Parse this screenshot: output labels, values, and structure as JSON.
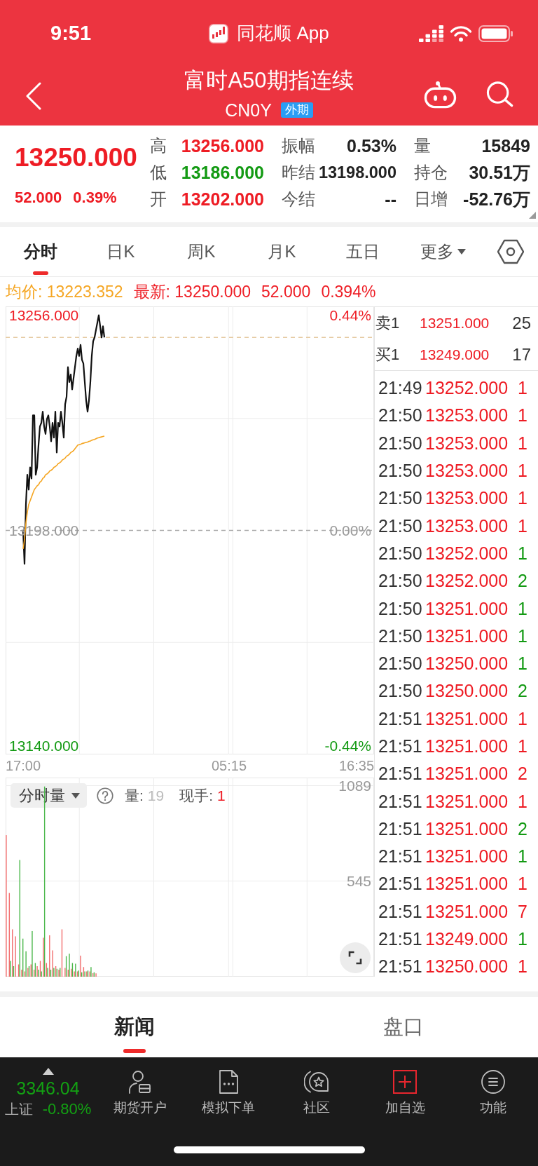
{
  "status_bar": {
    "time": "9:51",
    "app_name": "同花顺 App"
  },
  "header": {
    "title": "富时A50期指连续",
    "code": "CN0Y",
    "badge": "外期"
  },
  "quote": {
    "price": "13250.000",
    "change": "52.000",
    "change_percent": "0.39%",
    "color": "#ee1c24",
    "stats": [
      {
        "label": "高",
        "value": "13256.000",
        "color": "#ee1c24"
      },
      {
        "label": "振幅",
        "value": "0.53%",
        "color": "#222222"
      },
      {
        "label": "量",
        "value": "15849",
        "color": "#222222"
      },
      {
        "label": "低",
        "value": "13186.000",
        "color": "#139a13"
      },
      {
        "label": "昨结",
        "value": "13198.000",
        "color": "#222222"
      },
      {
        "label": "持仓",
        "value": "30.51万",
        "color": "#222222"
      },
      {
        "label": "开",
        "value": "13202.000",
        "color": "#ee1c24"
      },
      {
        "label": "今结",
        "value": "--",
        "color": "#222222"
      },
      {
        "label": "日增",
        "value": "-52.76万",
        "color": "#222222"
      }
    ]
  },
  "period_tabs": [
    {
      "label": "分时",
      "kind": "tab",
      "selected": true
    },
    {
      "label": "日K",
      "kind": "tab",
      "selected": false
    },
    {
      "label": "周K",
      "kind": "tab",
      "selected": false
    },
    {
      "label": "月K",
      "kind": "tab",
      "selected": false
    },
    {
      "label": "五日",
      "kind": "tab",
      "selected": false
    },
    {
      "label": "更多",
      "kind": "menu",
      "selected": false
    }
  ],
  "chart_info": {
    "average": "均价: 13223.352",
    "latest": "最新: 13250.000",
    "change": "52.000",
    "change_percent": "0.394%"
  },
  "price_chart": {
    "chart_data": {
      "type": "line",
      "categories": [
        "17:00",
        null,
        null,
        null,
        null,
        null,
        null,
        null,
        null,
        null,
        null,
        null,
        null,
        null,
        null,
        null,
        null,
        null,
        null,
        null,
        null,
        null,
        null,
        null,
        null,
        null,
        null,
        null,
        null,
        null,
        null,
        null,
        null,
        null,
        null,
        null,
        null,
        null,
        null,
        null,
        null,
        null,
        null,
        null,
        null,
        null,
        null,
        null,
        null,
        null,
        null,
        null,
        null,
        null,
        null,
        null,
        null,
        null,
        null,
        null,
        null,
        null,
        null,
        null,
        null,
        null,
        null,
        null,
        null,
        null,
        null,
        null,
        null,
        null,
        null,
        null,
        null,
        null,
        null,
        null,
        null,
        null,
        null,
        null,
        null,
        null,
        null,
        null,
        null,
        null,
        null,
        null,
        null,
        null,
        null,
        null,
        null,
        null,
        null,
        null,
        null,
        null,
        null,
        null,
        null,
        null,
        null,
        null,
        null,
        null,
        null,
        null,
        null,
        null,
        null,
        null,
        null,
        null,
        null,
        null,
        null,
        null,
        null,
        null,
        null,
        null,
        null,
        null,
        null,
        null,
        null,
        null,
        null,
        null,
        null,
        null,
        null,
        null,
        null,
        null,
        null,
        null,
        null,
        null,
        null,
        null,
        null,
        "05:15",
        null,
        null,
        null,
        null,
        null,
        null,
        null,
        null,
        null,
        null,
        null,
        null,
        null,
        null,
        null,
        null,
        null,
        null,
        null,
        null,
        null,
        null,
        null,
        null,
        null,
        null,
        null,
        null,
        null,
        null,
        null,
        null,
        null,
        null,
        null,
        null,
        null,
        null,
        null,
        null,
        null,
        null,
        null,
        null,
        null,
        null,
        null,
        null,
        null,
        null,
        null,
        null,
        null,
        null,
        null,
        null,
        null,
        null,
        null,
        null,
        null,
        null,
        null,
        null,
        null,
        null,
        null,
        null,
        null,
        null,
        null,
        null,
        null,
        null,
        null,
        null,
        null,
        null,
        null,
        null,
        null,
        null,
        null,
        null,
        null,
        null,
        null,
        null,
        null,
        null,
        "16:35"
      ],
      "series": [
        {
          "color": "#111111",
          "values": [
            13198,
            13189,
            13205,
            13213,
            13209,
            13215,
            13212,
            13229,
            13229,
            13213,
            13215,
            13221,
            13226,
            13227,
            13230,
            13226,
            13224,
            13228,
            13229,
            13226,
            13222,
            13227,
            13223,
            13230,
            13219,
            13227,
            13226,
            13230,
            13227,
            13223,
            13232,
            13234,
            13242,
            13238,
            13240,
            13236,
            13239,
            13242,
            13245,
            13247,
            13245,
            13248,
            13244,
            13243,
            13238,
            13233,
            13230,
            13233,
            13238,
            13245,
            13249,
            13250,
            13252,
            13254,
            13256,
            13253,
            13250,
            13253,
            13250,
            null,
            null,
            null,
            null,
            null,
            null,
            null,
            null,
            null,
            null,
            null,
            null,
            null,
            null,
            null,
            null,
            null,
            null,
            null,
            null,
            null,
            null,
            null,
            null,
            null,
            null,
            null,
            null,
            null,
            null,
            null,
            null,
            null,
            null,
            null,
            null,
            null,
            null,
            null,
            null,
            null,
            null,
            null,
            null,
            null,
            null,
            null,
            null,
            null,
            null,
            null,
            null,
            null,
            null,
            null,
            null,
            null,
            null,
            null,
            null,
            null,
            null,
            null,
            null,
            null,
            null,
            null,
            null,
            null,
            null,
            null,
            null,
            null,
            null,
            null,
            null,
            null,
            null,
            null,
            null,
            null,
            null,
            null,
            null,
            null,
            null,
            null,
            null,
            null,
            null,
            null,
            null,
            null,
            null,
            null,
            null,
            null,
            null,
            null,
            null,
            null,
            null,
            null,
            null,
            null,
            null,
            null,
            null,
            null,
            null,
            null,
            null,
            null,
            null,
            null,
            null,
            null,
            null,
            null,
            null,
            null,
            null,
            null,
            null,
            null,
            null,
            null,
            null,
            null,
            null,
            null,
            null,
            null,
            null,
            null,
            null,
            null,
            null,
            null,
            null,
            null,
            null,
            null,
            null,
            null,
            null,
            null,
            null,
            null,
            null,
            null,
            null,
            null,
            null,
            null,
            null,
            null,
            null,
            null,
            null,
            null,
            null,
            null,
            null,
            null,
            null,
            null,
            null,
            null,
            null,
            null,
            null,
            null,
            null,
            null,
            null,
            null,
            null,
            null,
            null
          ]
        },
        {
          "color": "#f5a623",
          "values": [
            13193,
            13195.5,
            13200,
            13203,
            13205,
            13206,
            13207,
            13208,
            13209,
            13209.5,
            13210,
            13210.3,
            13211,
            13211.3,
            13212,
            13212.3,
            13213,
            13213.2,
            13213.5,
            13214,
            13214.2,
            13214.5,
            13215,
            13215.2,
            13215.5,
            13216,
            13216.2,
            13216.5,
            13217,
            13217.2,
            13217.5,
            13218,
            13218.2,
            13218.5,
            13219,
            13219.2,
            13219.5,
            13220,
            13220.5,
            13221,
            13221.1,
            13221.2,
            13221.4,
            13221.5,
            13221.6,
            13221.7,
            13221.8,
            13222,
            13222.1,
            13222.3,
            13222.4,
            13222.5,
            13222.7,
            13222.9,
            13223,
            13223.1,
            13223.2,
            13223.3,
            13223.4,
            null,
            null,
            null,
            null,
            null,
            null,
            null,
            null,
            null,
            null,
            null,
            null,
            null,
            null,
            null,
            null,
            null,
            null,
            null,
            null,
            null,
            null,
            null,
            null,
            null,
            null,
            null,
            null,
            null,
            null,
            null,
            null,
            null,
            null,
            null,
            null,
            null,
            null,
            null,
            null,
            null,
            null,
            null,
            null,
            null,
            null,
            null,
            null,
            null,
            null,
            null,
            null,
            null,
            null,
            null,
            null,
            null,
            null,
            null,
            null,
            null,
            null,
            null,
            null,
            null,
            null,
            null,
            null,
            null,
            null,
            null,
            null,
            null,
            null,
            null,
            null,
            null,
            null,
            null,
            null,
            null,
            null,
            null,
            null,
            null,
            null,
            null,
            null,
            null,
            null,
            null,
            null,
            null,
            null,
            null,
            null,
            null,
            null,
            null,
            null,
            null,
            null,
            null,
            null,
            null,
            null,
            null,
            null,
            null,
            null,
            null,
            null,
            null,
            null,
            null,
            null,
            null,
            null,
            null,
            null,
            null,
            null,
            null,
            null,
            null,
            null,
            null,
            null,
            null,
            null,
            null,
            null,
            null,
            null,
            null,
            null,
            null,
            null,
            null,
            null,
            null,
            null,
            null,
            null,
            null,
            null,
            null,
            null,
            null,
            null,
            null,
            null,
            null,
            null,
            null,
            null,
            null,
            null,
            null,
            null,
            null,
            null,
            null,
            null,
            null,
            null,
            null,
            null,
            null,
            null,
            null,
            null,
            null,
            null,
            null,
            null,
            null,
            null,
            null,
            null
          ]
        }
      ],
      "ylim": [
        13140,
        13256
      ],
      "yticks": [
        {
          "value": 13256,
          "label": "13256.000"
        },
        {
          "value": 13198,
          "label": "13198.000"
        },
        {
          "value": 13140,
          "label": "13140.000"
        }
      ],
      "ref_lines": [
        {
          "axis": "y",
          "value": 13198,
          "color": "#aaaaaa"
        },
        {
          "axis": "y",
          "value": 13250,
          "color": "#e5c9a0"
        }
      ]
    },
    "right_ticks": [
      {
        "label": "0.44%",
        "color": "#ee1c24"
      },
      {
        "label": "0.00%",
        "color": "#999999"
      },
      {
        "label": "-0.44%",
        "color": "#139a13"
      }
    ]
  },
  "order_book": [
    {
      "label": "卖1",
      "price": "13251.000",
      "volume": "25"
    },
    {
      "label": "买1",
      "price": "13249.000",
      "volume": "17"
    }
  ],
  "trades": [
    {
      "time": "21:49",
      "price": "13252.000",
      "volume": "1",
      "color": "#ee1c24"
    },
    {
      "time": "21:50",
      "price": "13253.000",
      "volume": "1",
      "color": "#ee1c24"
    },
    {
      "time": "21:50",
      "price": "13253.000",
      "volume": "1",
      "color": "#ee1c24"
    },
    {
      "time": "21:50",
      "price": "13253.000",
      "volume": "1",
      "color": "#ee1c24"
    },
    {
      "time": "21:50",
      "price": "13253.000",
      "volume": "1",
      "color": "#ee1c24"
    },
    {
      "time": "21:50",
      "price": "13253.000",
      "volume": "1",
      "color": "#ee1c24"
    },
    {
      "time": "21:50",
      "price": "13252.000",
      "volume": "1",
      "color": "#139a13"
    },
    {
      "time": "21:50",
      "price": "13252.000",
      "volume": "2",
      "color": "#139a13"
    },
    {
      "time": "21:50",
      "price": "13251.000",
      "volume": "1",
      "color": "#139a13"
    },
    {
      "time": "21:50",
      "price": "13251.000",
      "volume": "1",
      "color": "#139a13"
    },
    {
      "time": "21:50",
      "price": "13250.000",
      "volume": "1",
      "color": "#139a13"
    },
    {
      "time": "21:50",
      "price": "13250.000",
      "volume": "2",
      "color": "#139a13"
    },
    {
      "time": "21:51",
      "price": "13251.000",
      "volume": "1",
      "color": "#ee1c24"
    },
    {
      "time": "21:51",
      "price": "13251.000",
      "volume": "1",
      "color": "#ee1c24"
    },
    {
      "time": "21:51",
      "price": "13251.000",
      "volume": "2",
      "color": "#ee1c24"
    },
    {
      "time": "21:51",
      "price": "13251.000",
      "volume": "1",
      "color": "#ee1c24"
    },
    {
      "time": "21:51",
      "price": "13251.000",
      "volume": "2",
      "color": "#139a13"
    },
    {
      "time": "21:51",
      "price": "13251.000",
      "volume": "1",
      "color": "#139a13"
    },
    {
      "time": "21:51",
      "price": "13251.000",
      "volume": "1",
      "color": "#ee1c24"
    },
    {
      "time": "21:51",
      "price": "13251.000",
      "volume": "7",
      "color": "#ee1c24"
    },
    {
      "time": "21:51",
      "price": "13249.000",
      "volume": "1",
      "color": "#139a13"
    },
    {
      "time": "21:51",
      "price": "13250.000",
      "volume": "1",
      "color": "#ee1c24"
    }
  ],
  "volume_chart": {
    "selector": "分时量",
    "readouts": [
      {
        "label": "量:",
        "value": "19",
        "color": "#bbbbbb"
      },
      {
        "label": "现手:",
        "value": "1",
        "color": "#ee1c24"
      }
    ],
    "chart_data": {
      "type": "bar",
      "stacked": false,
      "categories": [
        null,
        null,
        null,
        null,
        null,
        null,
        null,
        null,
        null,
        null,
        null,
        null,
        null,
        null,
        null,
        null,
        null,
        null,
        null,
        null,
        null,
        null,
        null,
        null,
        null,
        null,
        null,
        null,
        null,
        null,
        null,
        null,
        null,
        null,
        null,
        null,
        null,
        null,
        null,
        null,
        null,
        null,
        null,
        null,
        null,
        null,
        null,
        null,
        null,
        null,
        null,
        null,
        null,
        null,
        null,
        null,
        null,
        null,
        null,
        null,
        null,
        null,
        null,
        null,
        null,
        null,
        null,
        null,
        null,
        null,
        null,
        null,
        null,
        null,
        null,
        null,
        null,
        null,
        null,
        null,
        null,
        null,
        null,
        null,
        null,
        null,
        null,
        null,
        null,
        null,
        null,
        null,
        null,
        null,
        null,
        null,
        null,
        null,
        null,
        null,
        null,
        null,
        null,
        null,
        null,
        null,
        null,
        null,
        null,
        null,
        null,
        null,
        null,
        null,
        null,
        null,
        null,
        null,
        null,
        null
      ],
      "series": [
        {
          "color": "#f26d6d",
          "values": [
            807,
            477,
            270,
            230,
            70,
            40,
            30,
            50,
            70,
            40,
            60,
            90,
            222,
            78,
            236,
            150,
            60,
            40,
            270,
            50,
            40,
            45,
            30,
            30,
            120,
            55,
            30,
            30,
            20,
            19,
            null,
            null,
            null,
            null,
            null,
            null,
            null,
            null,
            null,
            null,
            null,
            null,
            null,
            null,
            null,
            null,
            null,
            null,
            null,
            null,
            null,
            null,
            null,
            null,
            null,
            null,
            null,
            null,
            null,
            null,
            null,
            null,
            null,
            null,
            null,
            null,
            null,
            null,
            null,
            null,
            null,
            null,
            null,
            null,
            null,
            null,
            null,
            null,
            null,
            null,
            null,
            null,
            null,
            null,
            null,
            null,
            null,
            null,
            null,
            null,
            null,
            null,
            null,
            null,
            null,
            null,
            null,
            null,
            null,
            null,
            null,
            null,
            null,
            null,
            null,
            null,
            null,
            null,
            null,
            null,
            null,
            null,
            null,
            null,
            null,
            null,
            null,
            null,
            null,
            null
          ]
        },
        {
          "color": "#4cb84c",
          "values": [
            null,
            90,
            60,
            null,
            665,
            217,
            145,
            60,
            260,
            78,
            40,
            30,
            1084,
            50,
            40,
            50,
            45,
            50,
            null,
            117,
            131,
            78,
            74,
            35,
            25,
            30,
            35,
            55,
            25,
            null,
            null,
            null,
            null,
            null,
            null,
            null,
            null,
            null,
            null,
            null,
            null,
            null,
            null,
            null,
            null,
            null,
            null,
            null,
            null,
            null,
            null,
            null,
            null,
            null,
            null,
            null,
            null,
            null,
            null,
            null,
            null,
            null,
            null,
            null,
            null,
            null,
            null,
            null,
            null,
            null,
            null,
            null,
            null,
            null,
            null,
            null,
            null,
            null,
            null,
            null,
            null,
            null,
            null,
            null,
            null,
            null,
            null,
            null,
            null,
            null,
            null,
            null,
            null,
            null,
            null,
            null,
            null,
            null,
            null,
            null,
            null,
            null,
            null,
            null,
            null,
            null,
            null,
            null,
            null,
            null,
            null,
            null,
            null,
            null,
            null,
            null,
            null,
            null,
            null,
            null
          ]
        }
      ],
      "ylim": [
        0,
        1089
      ],
      "yticks": [
        {
          "value": 545,
          "label": "545"
        },
        {
          "value": 1089,
          "label": "1089"
        }
      ]
    }
  },
  "detail_tabs": [
    {
      "label": "新闻",
      "selected": true
    },
    {
      "label": "盘口",
      "selected": false
    }
  ],
  "index_ticker": {
    "value": "3346.04",
    "name": "上证",
    "change": "-0.80%",
    "color": "#13a113"
  },
  "toolbar": [
    {
      "label": "期货开户",
      "kind": "account"
    },
    {
      "label": "模拟下单",
      "kind": "order"
    },
    {
      "label": "社区",
      "kind": "community"
    },
    {
      "label": "加自选",
      "kind": "add"
    },
    {
      "label": "功能",
      "kind": "menu"
    }
  ]
}
